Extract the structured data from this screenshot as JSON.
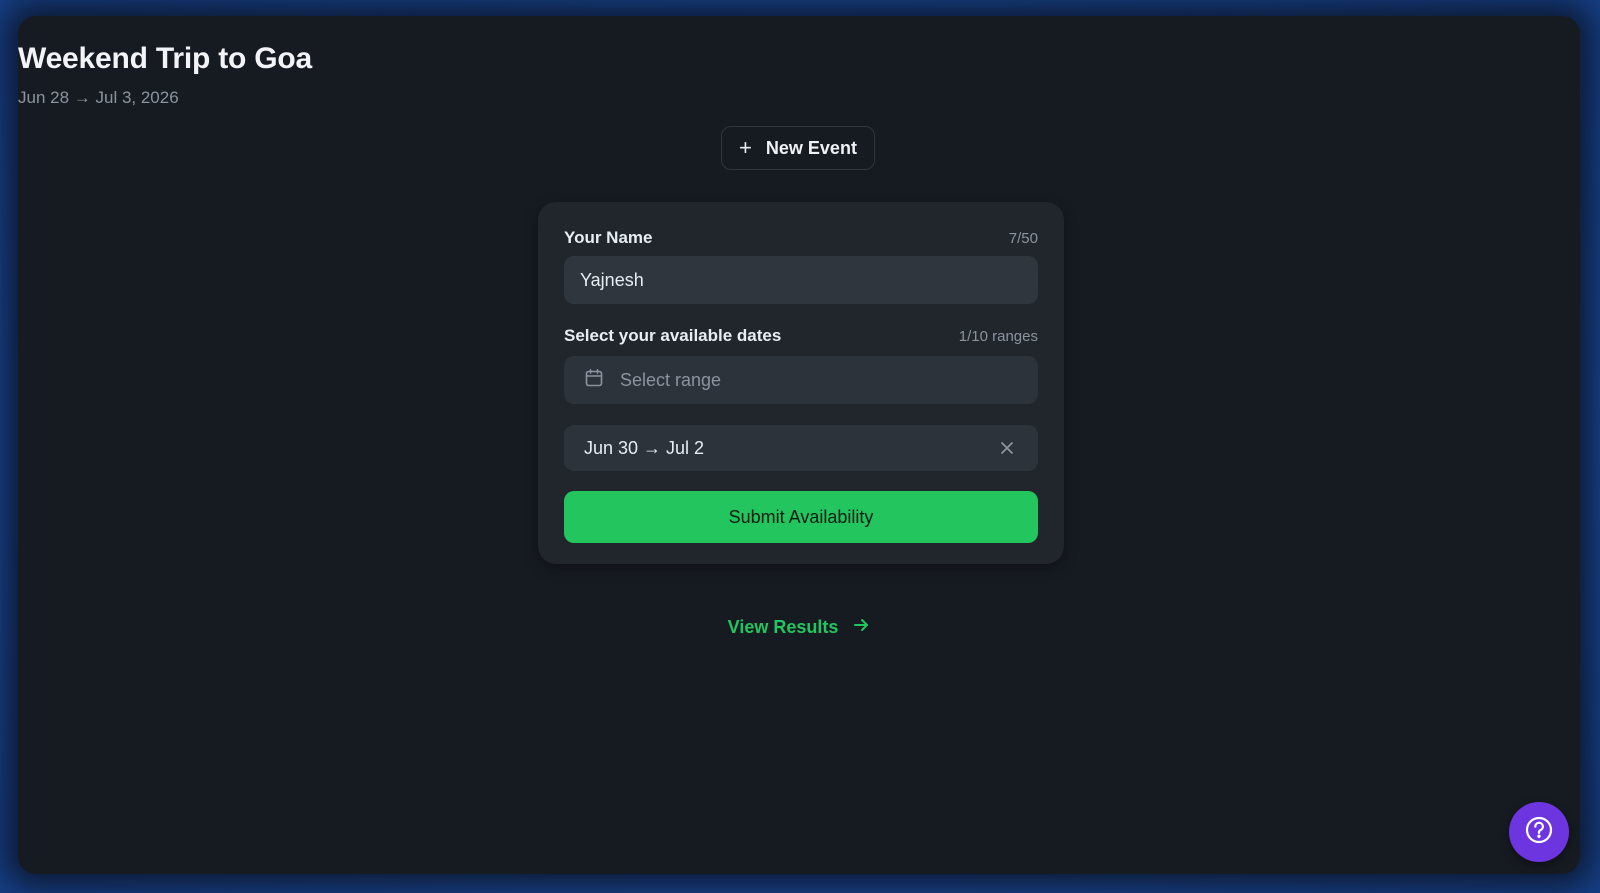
{
  "header": {
    "title": "Weekend Trip to Goa",
    "date_range": "Jun 28 → Jul 3, 2026",
    "new_event_label": "New Event"
  },
  "form": {
    "name_label": "Your Name",
    "name_counter": "7/50",
    "name_value": "Yajnesh",
    "dates_label": "Select your available dates",
    "dates_counter": "1/10 ranges",
    "range_placeholder": "Select range",
    "selected_ranges": [
      "Jun 30 → Jul 2"
    ],
    "submit_label": "Submit Availability"
  },
  "footer": {
    "view_results_label": "View Results"
  },
  "icons": {
    "new_event": "plus-icon",
    "range_picker": "calendar-icon",
    "remove_range": "close-icon",
    "view_results": "arrow-right-icon",
    "help": "help-circle-icon"
  },
  "colors": {
    "background": "#161b22",
    "card": "#21262c",
    "accent": "#22c55e",
    "help_button": "#6d35e0",
    "outer_frame": "#1e4fa8"
  }
}
